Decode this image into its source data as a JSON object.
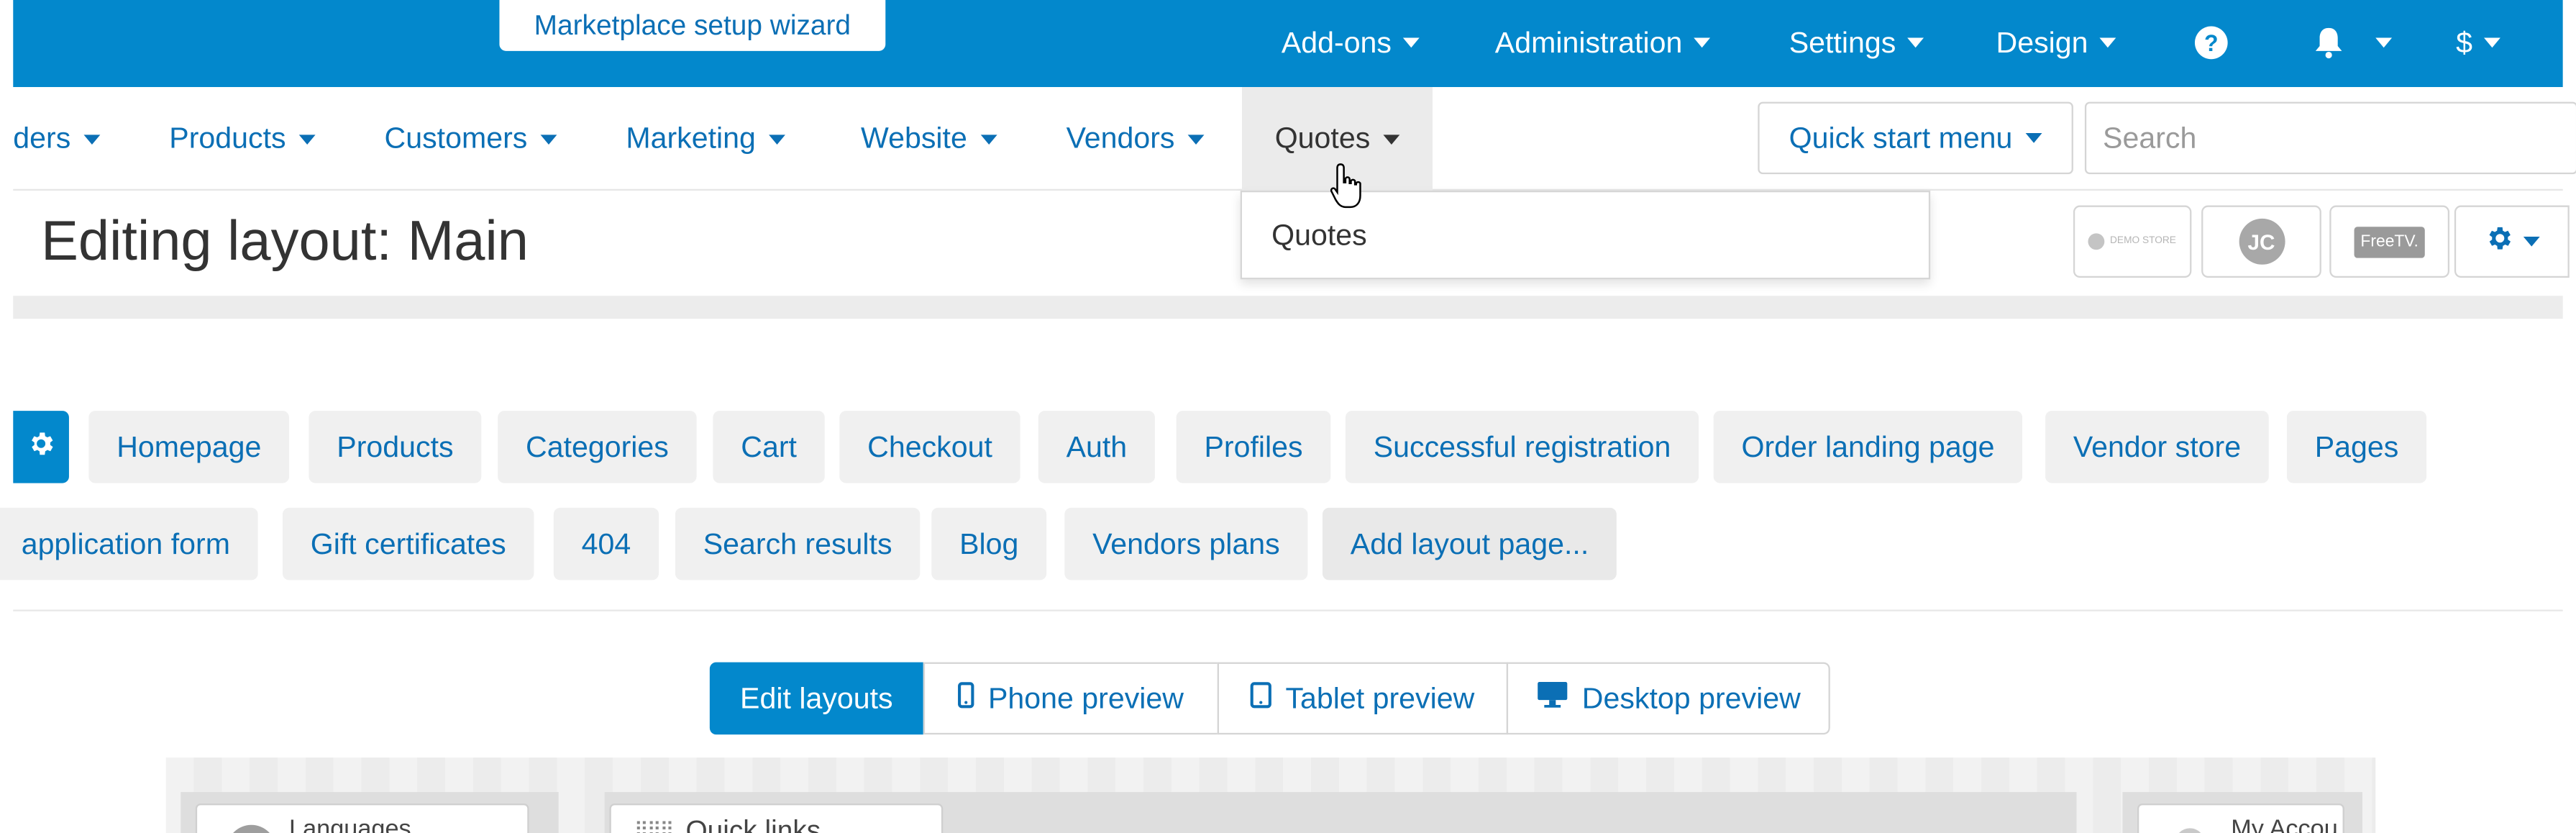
{
  "topbar": {
    "wizard_label": "Marketplace setup wizard",
    "addons_label": "Add-ons",
    "administration_label": "Administration",
    "settings_label": "Settings",
    "design_label": "Design",
    "help_glyph": "?",
    "currency_label": "$",
    "icons": [
      "help-icon",
      "bell-icon"
    ]
  },
  "nav": {
    "orders_label": "ders",
    "products_label": "Products",
    "customers_label": "Customers",
    "marketing_label": "Marketing",
    "website_label": "Website",
    "vendors_label": "Vendors",
    "quotes_label": "Quotes",
    "quick_start_label": "Quick start menu",
    "search_placeholder": "Search"
  },
  "dropdown": {
    "item_label": "Quotes"
  },
  "page": {
    "title": "Editing layout: Main",
    "logo_demo_store": "DEMO STORE",
    "logo_jc": "JC",
    "logo_freetv": "FreeTV."
  },
  "layout_tabs": {
    "row1": [
      "Homepage",
      "Products",
      "Categories",
      "Cart",
      "Checkout",
      "Auth",
      "Profiles",
      "Successful registration",
      "Order landing page",
      "Vendor store",
      "Pages"
    ],
    "row2": [
      "application form",
      "Gift certificates",
      "404",
      "Search results",
      "Blog",
      "Vendors plans",
      "Add layout page..."
    ]
  },
  "preview": {
    "edit_label": "Edit layouts",
    "phone_label": "Phone preview",
    "tablet_label": "Tablet preview",
    "desktop_label": "Desktop preview"
  },
  "canvas": {
    "languages_label": "Languages",
    "quick_links_label": "Quick links",
    "my_account_label": "My Accou"
  },
  "colors": {
    "primary": "#0388cc",
    "link": "#0b6fb5"
  }
}
